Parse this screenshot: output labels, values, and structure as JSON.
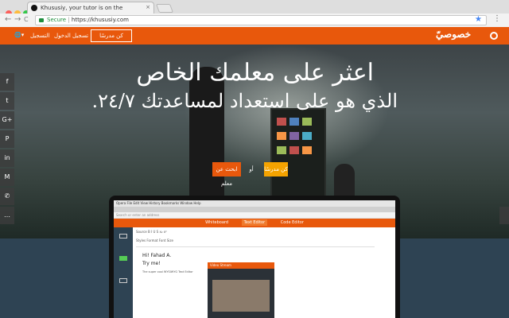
{
  "browser": {
    "tab_title": "Khususiy, your tutor is on the",
    "tab_close": "×",
    "back": "←",
    "forward": "→",
    "reload": "C",
    "secure_label": "Secure",
    "url": "https://khususiy.com",
    "bookmark": "★",
    "menu": "⋮"
  },
  "nav": {
    "logo_text": "خصوصيّ",
    "tutor_button": "كن مدرسًا",
    "login": "تسجيل الدخول",
    "signup": "التسجيل",
    "lang_caret": "▾"
  },
  "hero": {
    "title": "اعثر على معلمك الخاص",
    "subtitle": "الذي هو على استعداد لمساعدتك ٢٤/٧.",
    "cta_tutor": "كن مدرسًا",
    "cta_or": "أو",
    "cta_find": "ابحث عن معلم"
  },
  "share": [
    {
      "icon": "facebook-icon",
      "glyph": "f"
    },
    {
      "icon": "twitter-icon",
      "glyph": "t"
    },
    {
      "icon": "google-plus-icon",
      "glyph": "G+"
    },
    {
      "icon": "pinterest-icon",
      "glyph": "P"
    },
    {
      "icon": "linkedin-icon",
      "glyph": "in"
    },
    {
      "icon": "gmail-icon",
      "glyph": "M"
    },
    {
      "icon": "whatsapp-icon",
      "glyph": "✆"
    },
    {
      "icon": "sms-icon",
      "glyph": "…"
    }
  ],
  "laptop": {
    "menubar": "Opera  File  Edit  View  History  Bookmarks  Window  Help",
    "address": "Search or enter an address",
    "tabs": [
      "Whiteboard",
      "Text Editor",
      "Code Editor"
    ],
    "toolbar1": "Source   B  I  U  S  x₂  x²",
    "toolbar2": "Styles   Format   Font   Size",
    "greeting": "Hi! Fahad A.",
    "try": "Try me!",
    "desc": "The super cool WYSIWYG Text Editor",
    "video_title": "Video Stream"
  },
  "colors": {
    "brand_orange": "#e8580c",
    "cta_yellow": "#f5a300",
    "panel_navy": "#2e4353"
  }
}
